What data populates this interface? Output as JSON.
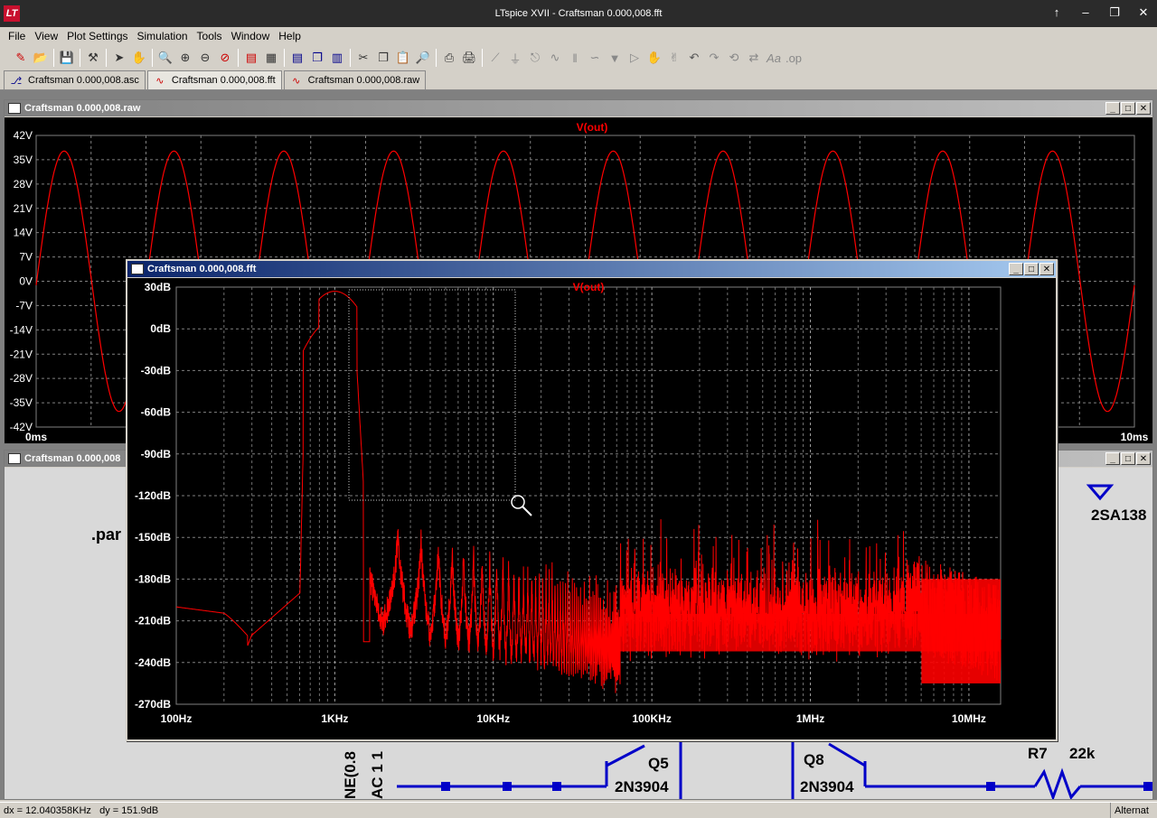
{
  "app": {
    "title": "LTspice XVII - Craftsman 0.000,008.fft",
    "window_controls": [
      "↑",
      "–",
      "❐",
      "✕"
    ]
  },
  "menu": [
    "File",
    "View",
    "Plot Settings",
    "Simulation",
    "Tools",
    "Window",
    "Help"
  ],
  "tabs": [
    {
      "label": "Craftsman 0.000,008.asc",
      "icon": "schematic-icon"
    },
    {
      "label": "Craftsman 0.000,008.fft",
      "icon": "waveform-icon",
      "active": true
    },
    {
      "label": "Craftsman 0.000,008.raw",
      "icon": "waveform-icon"
    }
  ],
  "raw_window": {
    "title": "Craftsman 0.000,008.raw",
    "trace_label": "V(out)",
    "y_ticks": [
      "42V",
      "35V",
      "28V",
      "21V",
      "14V",
      "7V",
      "0V",
      "-7V",
      "-14V",
      "-21V",
      "-28V",
      "-35V",
      "-42V"
    ],
    "x_ticks": [
      "0ms",
      "10ms"
    ],
    "trace_color": "#ff0000"
  },
  "schematic_window": {
    "title": "Craftsman 0.000,008",
    "labels": {
      "param": ".par",
      "part_right": "2SA138",
      "q5_ref": "Q5",
      "q5_model": "2N3904",
      "q8_ref": "Q8",
      "q8_model": "2N3904",
      "r7_ref": "R7",
      "r7_value": "22k",
      "vert1": "NE(0.8",
      "vert2": "AC 1 1"
    }
  },
  "fft_window": {
    "title": "Craftsman 0.000,008.fft",
    "trace_label": "V(out)",
    "y_ticks": [
      "30dB",
      "0dB",
      "-30dB",
      "-60dB",
      "-90dB",
      "-120dB",
      "-150dB",
      "-180dB",
      "-210dB",
      "-240dB",
      "-270dB"
    ],
    "x_ticks": [
      "100Hz",
      "1KHz",
      "10KHz",
      "100KHz",
      "1MHz",
      "10MHz"
    ],
    "trace_color": "#ff0000"
  },
  "status": {
    "left": "dx = 12.040358KHz   dy = 151.9dB",
    "right": "Alternat"
  }
}
